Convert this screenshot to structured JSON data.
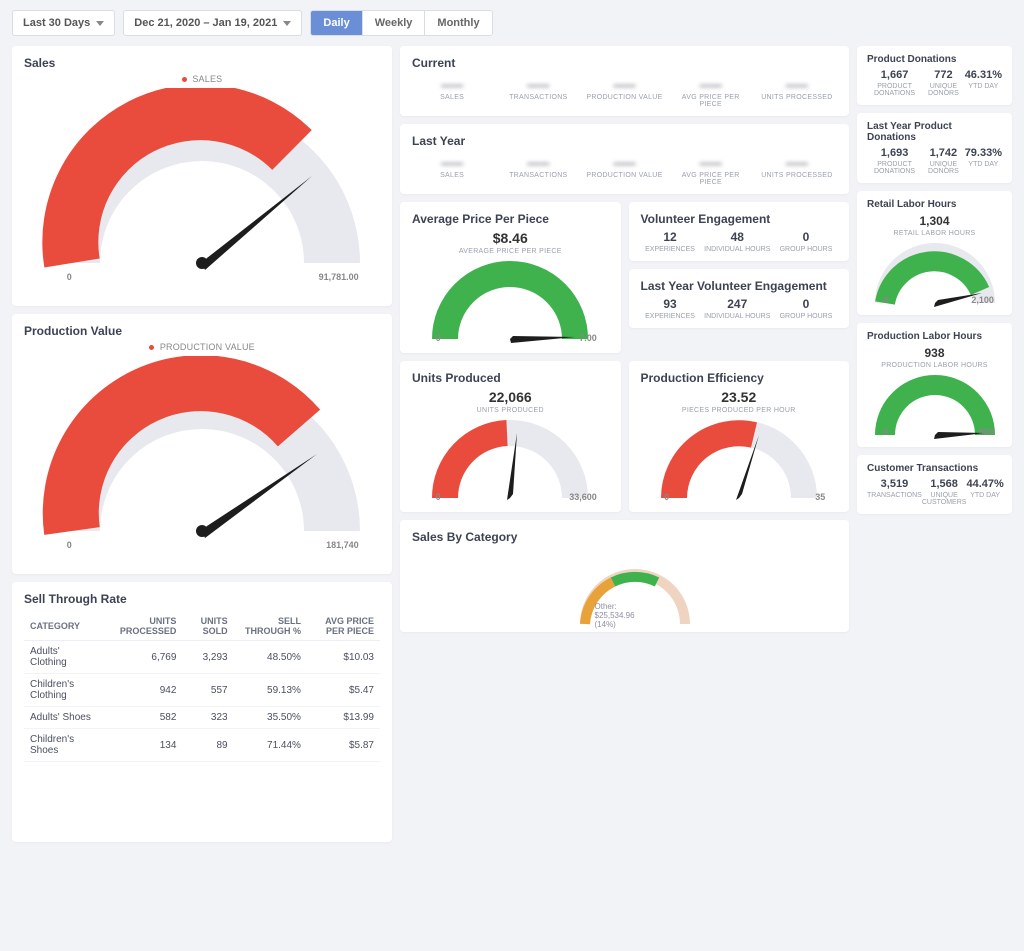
{
  "toolbar": {
    "range_label": "Last 30 Days",
    "date_range_label": "Dec 21, 2020 – Jan 19, 2021",
    "granularity": {
      "daily": "Daily",
      "weekly": "Weekly",
      "monthly": "Monthly",
      "active": "daily"
    }
  },
  "sales_card": {
    "title": "Sales",
    "legend": "SALES",
    "min": "0",
    "max": "91,781.00"
  },
  "production_value_card": {
    "title": "Production Value",
    "legend": "PRODUCTION VALUE",
    "min": "0",
    "max": "181,740"
  },
  "current_strip": {
    "title": "Current",
    "items": [
      {
        "val": "——",
        "lbl": "SALES",
        "dot": "green"
      },
      {
        "val": "——",
        "lbl": "TRANSACTIONS",
        "dot": "blue"
      },
      {
        "val": "——",
        "lbl": "PRODUCTION VALUE",
        "dot": "teal"
      },
      {
        "val": "——",
        "lbl": "AVG PRICE PER PIECE",
        "dot": "orange"
      },
      {
        "val": "——",
        "lbl": "UNITS PROCESSED",
        "dot": "purple"
      }
    ]
  },
  "lastyear_strip": {
    "title": "Last Year",
    "items": [
      {
        "val": "——",
        "lbl": "SALES",
        "dot": "green"
      },
      {
        "val": "——",
        "lbl": "TRANSACTIONS",
        "dot": "blue"
      },
      {
        "val": "——",
        "lbl": "PRODUCTION VALUE",
        "dot": "teal"
      },
      {
        "val": "——",
        "lbl": "AVG PRICE PER PIECE",
        "dot": "orange"
      },
      {
        "val": "——",
        "lbl": "UNITS PROCESSED",
        "dot": "purple"
      }
    ]
  },
  "avg_price_card": {
    "title": "Average Price Per Piece",
    "value": "$8.46",
    "sublabel": "AVERAGE PRICE PER PIECE",
    "min": "0",
    "max": "7.00"
  },
  "vol_engage": {
    "title": "Volunteer Engagement",
    "cells": [
      {
        "v": "12",
        "l": "EXPERIENCES"
      },
      {
        "v": "48",
        "l": "INDIVIDUAL HOURS"
      },
      {
        "v": "0",
        "l": "GROUP HOURS"
      }
    ]
  },
  "vol_engage_ly": {
    "title": "Last Year Volunteer Engagement",
    "cells": [
      {
        "v": "93",
        "l": "EXPERIENCES"
      },
      {
        "v": "247",
        "l": "INDIVIDUAL HOURS"
      },
      {
        "v": "0",
        "l": "GROUP HOURS"
      }
    ]
  },
  "units_produced_card": {
    "title": "Units Produced",
    "value": "22,066",
    "sublabel": "UNITS PRODUCED",
    "min": "0",
    "max": "33,600"
  },
  "prod_efficiency_card": {
    "title": "Production Efficiency",
    "value": "23.52",
    "sublabel": "PIECES PRODUCED PER HOUR",
    "min": "0",
    "max": "35"
  },
  "sales_by_cat": {
    "title": "Sales By Category",
    "center_label": "Other: $25,534.96  (14%)"
  },
  "sell_through": {
    "title": "Sell Through Rate",
    "headers": [
      "CATEGORY",
      "UNITS PROCESSED",
      "UNITS SOLD",
      "SELL THROUGH %",
      "AVG PRICE PER PIECE"
    ],
    "rows": [
      [
        "Adults' Clothing",
        "6,769",
        "3,293",
        "48.50%",
        "$10.03"
      ],
      [
        "Children's Clothing",
        "942",
        "557",
        "59.13%",
        "$5.47"
      ],
      [
        "Adults' Shoes",
        "582",
        "323",
        "35.50%",
        "$13.99"
      ],
      [
        "Children's Shoes",
        "134",
        "89",
        "71.44%",
        "$5.87"
      ]
    ]
  },
  "right": {
    "product_donations": {
      "title": "Product Donations",
      "cells": [
        {
          "v": "1,667",
          "l": "PRODUCT DONATIONS"
        },
        {
          "v": "772",
          "l": "UNIQUE DONORS"
        },
        {
          "v": "46.31%",
          "l": "YTD DAY"
        }
      ]
    },
    "product_donations_ly": {
      "title": "Last Year Product Donations",
      "cells": [
        {
          "v": "1,693",
          "l": "PRODUCT DONATIONS"
        },
        {
          "v": "1,742",
          "l": "UNIQUE DONORS"
        },
        {
          "v": "79.33%",
          "l": "YTD DAY"
        }
      ]
    },
    "retail_labor": {
      "title": "Retail Labor Hours",
      "value": "1,304",
      "sublabel": "RETAIL LABOR HOURS",
      "min": "0",
      "max": "2,100"
    },
    "production_labor": {
      "title": "Production Labor Hours",
      "value": "938",
      "sublabel": "PRODUCTION LABOR HOURS",
      "min": "0",
      "max": "900"
    },
    "customer_tx": {
      "title": "Customer Transactions",
      "cells": [
        {
          "v": "3,519",
          "l": "TRANSACTIONS"
        },
        {
          "v": "1,568",
          "l": "UNIQUE CUSTOMERS"
        },
        {
          "v": "44.47%",
          "l": "YTD DAY"
        }
      ]
    }
  },
  "chart_data": [
    {
      "type": "gauge",
      "id": "sales",
      "series": "SALES",
      "color": "#e94b3c",
      "min": 0,
      "max": 91781,
      "value": null,
      "fill_fraction": 0.72
    },
    {
      "type": "gauge",
      "id": "production_value",
      "series": "PRODUCTION VALUE",
      "color": "#e94b3c",
      "min": 0,
      "max": 181740,
      "value": null,
      "fill_fraction": 0.75
    },
    {
      "type": "gauge",
      "id": "avg_price",
      "series": "AVERAGE PRICE PER PIECE",
      "color": "#3fb24d",
      "min": 0,
      "max": 7.0,
      "value": 8.46,
      "fill_fraction": 1.0
    },
    {
      "type": "gauge",
      "id": "units_produced",
      "series": "UNITS PRODUCED",
      "color": "#e94b3c",
      "min": 0,
      "max": 33600,
      "value": 22066,
      "fill_fraction": 0.45
    },
    {
      "type": "gauge",
      "id": "prod_efficiency",
      "series": "PIECES PRODUCED PER HOUR",
      "color": "#e94b3c",
      "min": 0,
      "max": 35,
      "value": 23.52,
      "fill_fraction": 0.55
    },
    {
      "type": "gauge",
      "id": "retail_labor",
      "series": "RETAIL LABOR HOURS",
      "color": "#3fb24d",
      "min": 0,
      "max": 2100,
      "value": 1304,
      "fill_fraction": 0.9
    },
    {
      "type": "gauge",
      "id": "production_labor",
      "series": "PRODUCTION LABOR HOURS",
      "color": "#3fb24d",
      "min": 0,
      "max": 900,
      "value": 938,
      "fill_fraction": 1.0
    }
  ]
}
